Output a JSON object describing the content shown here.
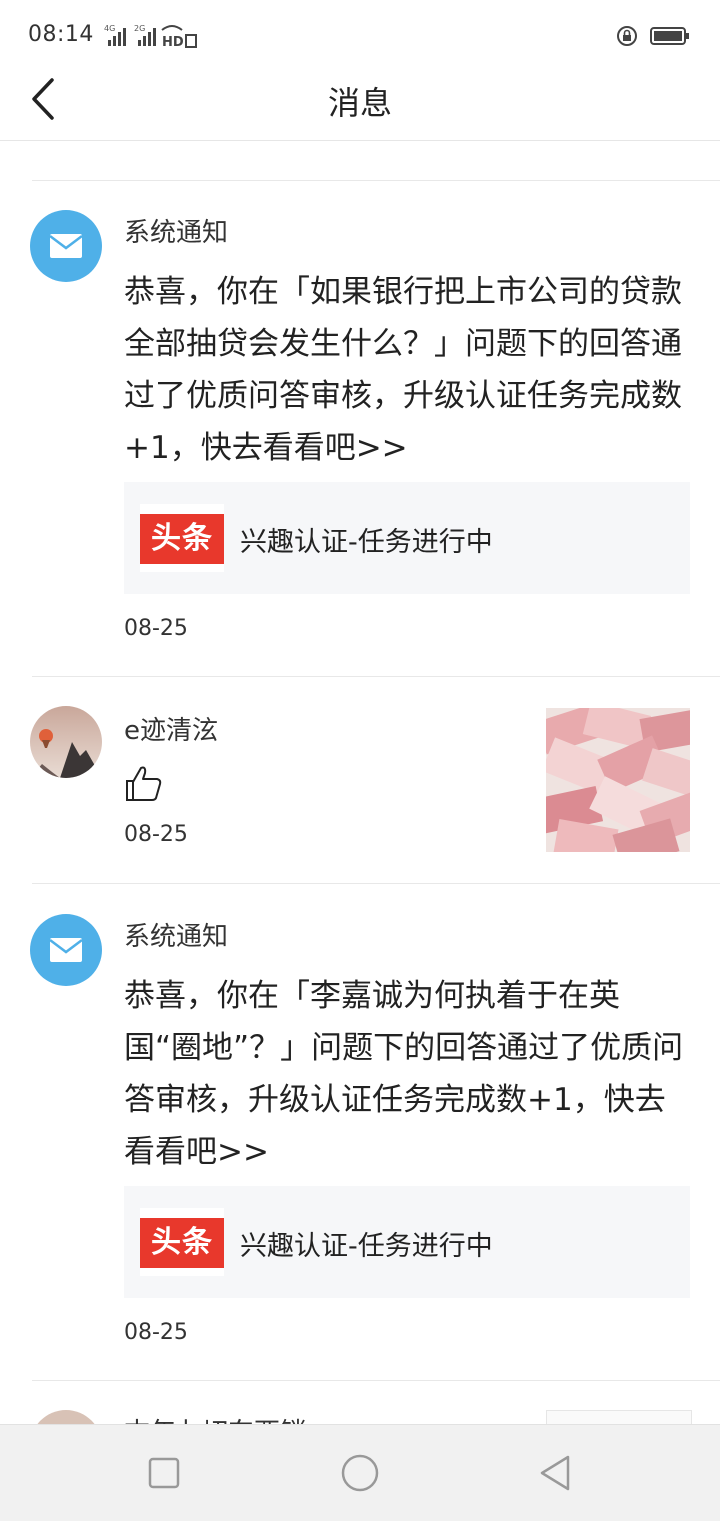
{
  "status_bar": {
    "time": "08:14",
    "net1": "4G",
    "net2": "2G",
    "hd": "HD"
  },
  "header": {
    "title": "消息"
  },
  "messages": [
    {
      "sender": "系统通知",
      "text": "恭喜，你在「如果银行把上市公司的贷款全部抽贷会发生什么？」问题下的回答通过了优质问答审核，升级认证任务完成数+1，快去看看吧>>",
      "card": {
        "logo": "头条",
        "title": "兴趣认证-任务进行中"
      },
      "date": "08-25"
    },
    {
      "sender": "e迹清泫",
      "action_icon": "thumbs-up-icon",
      "date": "08-25"
    },
    {
      "sender": "系统通知",
      "text": "恭喜，你在「李嘉诚为何执着于在英国“圈地”？」问题下的回答通过了优质问答审核，升级认证任务完成数+1，快去看看吧>>",
      "card": {
        "logo": "头条",
        "title": "兴趣认证-任务进行中"
      },
      "date": "08-25"
    },
    {
      "sender": "末年七切东西销"
    }
  ],
  "colors": {
    "accent_blue": "#4fb0e8",
    "logo_red": "#e8382c"
  }
}
